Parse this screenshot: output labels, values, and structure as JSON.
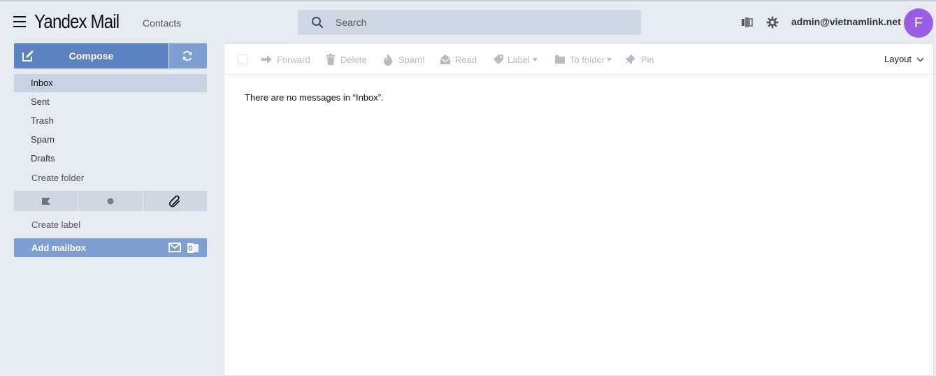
{
  "header": {
    "logo_brand": "Yandex",
    "logo_product": "Mail",
    "contacts_label": "Contacts",
    "search_placeholder": "Search",
    "user_email": "admin@vietnamlink.net",
    "avatar_letter": "F",
    "avatar_color": "#9b5de5"
  },
  "sidebar": {
    "compose_label": "Compose",
    "folders": [
      {
        "label": "Inbox",
        "active": true
      },
      {
        "label": "Sent"
      },
      {
        "label": "Trash"
      },
      {
        "label": "Spam"
      },
      {
        "label": "Drafts"
      }
    ],
    "create_folder_label": "Create folder",
    "filters": [
      "flag-icon",
      "unread-dot-icon",
      "attachment-icon"
    ],
    "create_label_label": "Create label",
    "add_mailbox_label": "Add mailbox"
  },
  "toolbar": {
    "forward": "Forward",
    "delete": "Delete",
    "spam": "Spam!",
    "read": "Read",
    "label": "Label",
    "to_folder": "To folder",
    "pin": "Pin",
    "layout": "Layout"
  },
  "main": {
    "empty_message": "There are no messages in “Inbox”."
  },
  "colors": {
    "accent": "#5b82c1",
    "accent_light": "#7e9fd2",
    "background": "#e6eaf1"
  }
}
